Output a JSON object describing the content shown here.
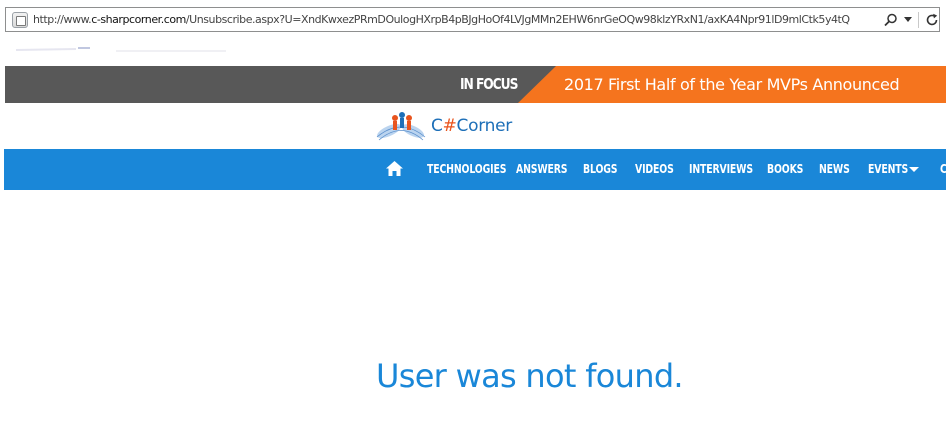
{
  "browser": {
    "url_prefix": "http://www.",
    "url_domain": "c-sharpcorner.com",
    "url_rest": "/Unsubscribe.aspx?U=XndKwxezPRmDOulogHXrpB4pBJgHoOf4LVJgMMn2EHW6nrGeOQw98klzYRxN1/axKA4Npr91lD9mlCtk5y4tQ",
    "icons": [
      "page-icon",
      "search-icon",
      "dropdown-icon",
      "refresh-icon"
    ]
  },
  "focus": {
    "label": "IN FOCUS",
    "headline": "2017 First Half of the Year MVPs Announced"
  },
  "logo": {
    "text_prefix": "C",
    "text_hash": "#",
    "text_suffix": "Corner"
  },
  "nav": {
    "items": [
      "TECHNOLOGIES",
      "ANSWERS",
      "BLOGS",
      "VIDEOS",
      "INTERVIEWS",
      "BOOKS",
      "NEWS",
      "EVENTS",
      "C"
    ]
  },
  "message": "User was not found.",
  "colors": {
    "focus_bg": "#585858",
    "focus_accent": "#f5741e",
    "nav_bg": "#1a87d8",
    "message": "#1a87d8"
  }
}
